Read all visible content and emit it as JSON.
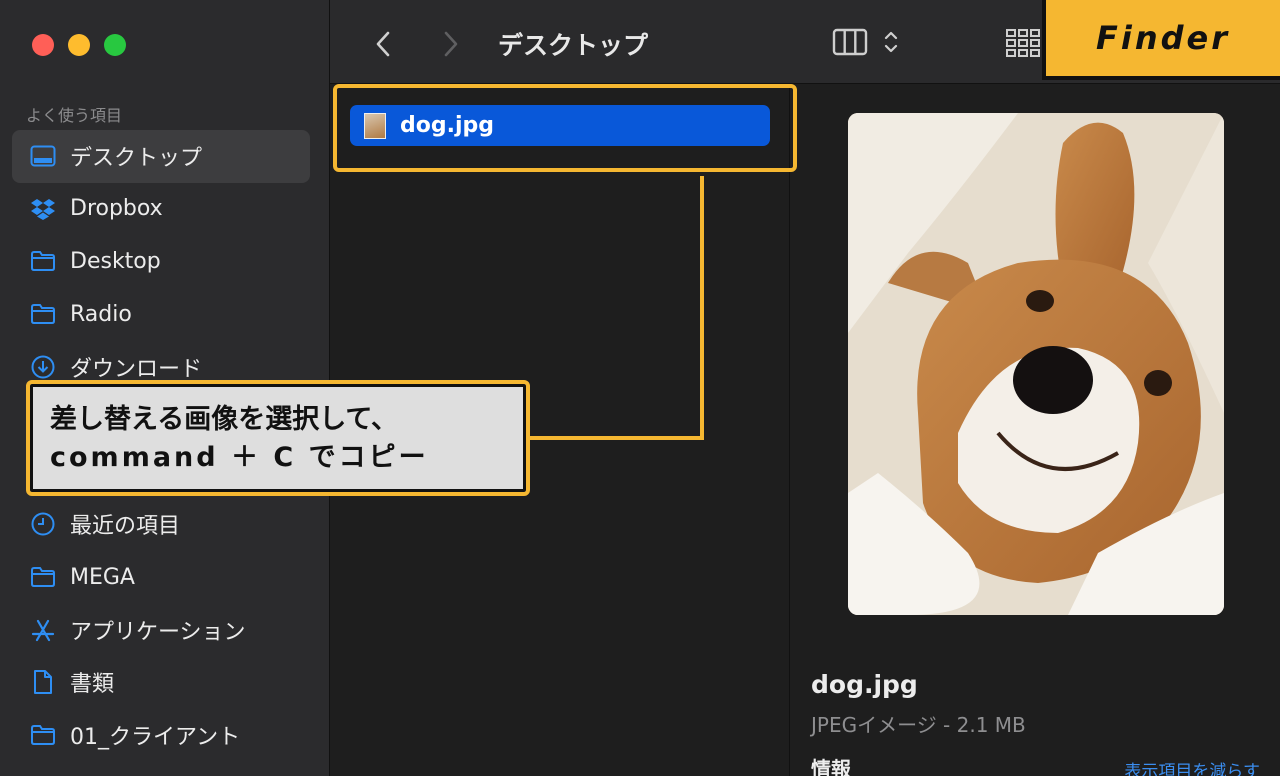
{
  "window": {
    "title": "デスクトップ"
  },
  "colors": {
    "accent": "#f5b731",
    "selection": "#0958d9",
    "folder_icon": "#2e8ef3"
  },
  "sidebar": {
    "section_title": "よく使う項目",
    "items": [
      {
        "label": "デスクトップ",
        "icon": "desktop-icon"
      },
      {
        "label": "Dropbox",
        "icon": "dropbox-icon"
      },
      {
        "label": "Desktop",
        "icon": "folder-icon"
      },
      {
        "label": "Radio",
        "icon": "folder-icon"
      },
      {
        "label": "ダウンロード",
        "icon": "download-icon"
      },
      {
        "label": "",
        "icon": ""
      },
      {
        "label": "",
        "icon": ""
      },
      {
        "label": "最近の項目",
        "icon": "clock-icon"
      },
      {
        "label": "MEGA",
        "icon": "folder-icon"
      },
      {
        "label": "アプリケーション",
        "icon": "applications-icon"
      },
      {
        "label": "書類",
        "icon": "document-icon"
      },
      {
        "label": "01_クライアント",
        "icon": "folder-icon"
      }
    ]
  },
  "files": [
    {
      "name": "dog.jpg",
      "selected": true
    }
  ],
  "preview": {
    "name": "dog.jpg",
    "kind": "JPEGイメージ - 2.1 MB",
    "info_label": "情報",
    "show_less": "表示項目を減らす"
  },
  "annotation": {
    "line1": "差し替える画像を選択して、",
    "line2": "command ＋ C でコピー",
    "app_label": "Finder"
  }
}
